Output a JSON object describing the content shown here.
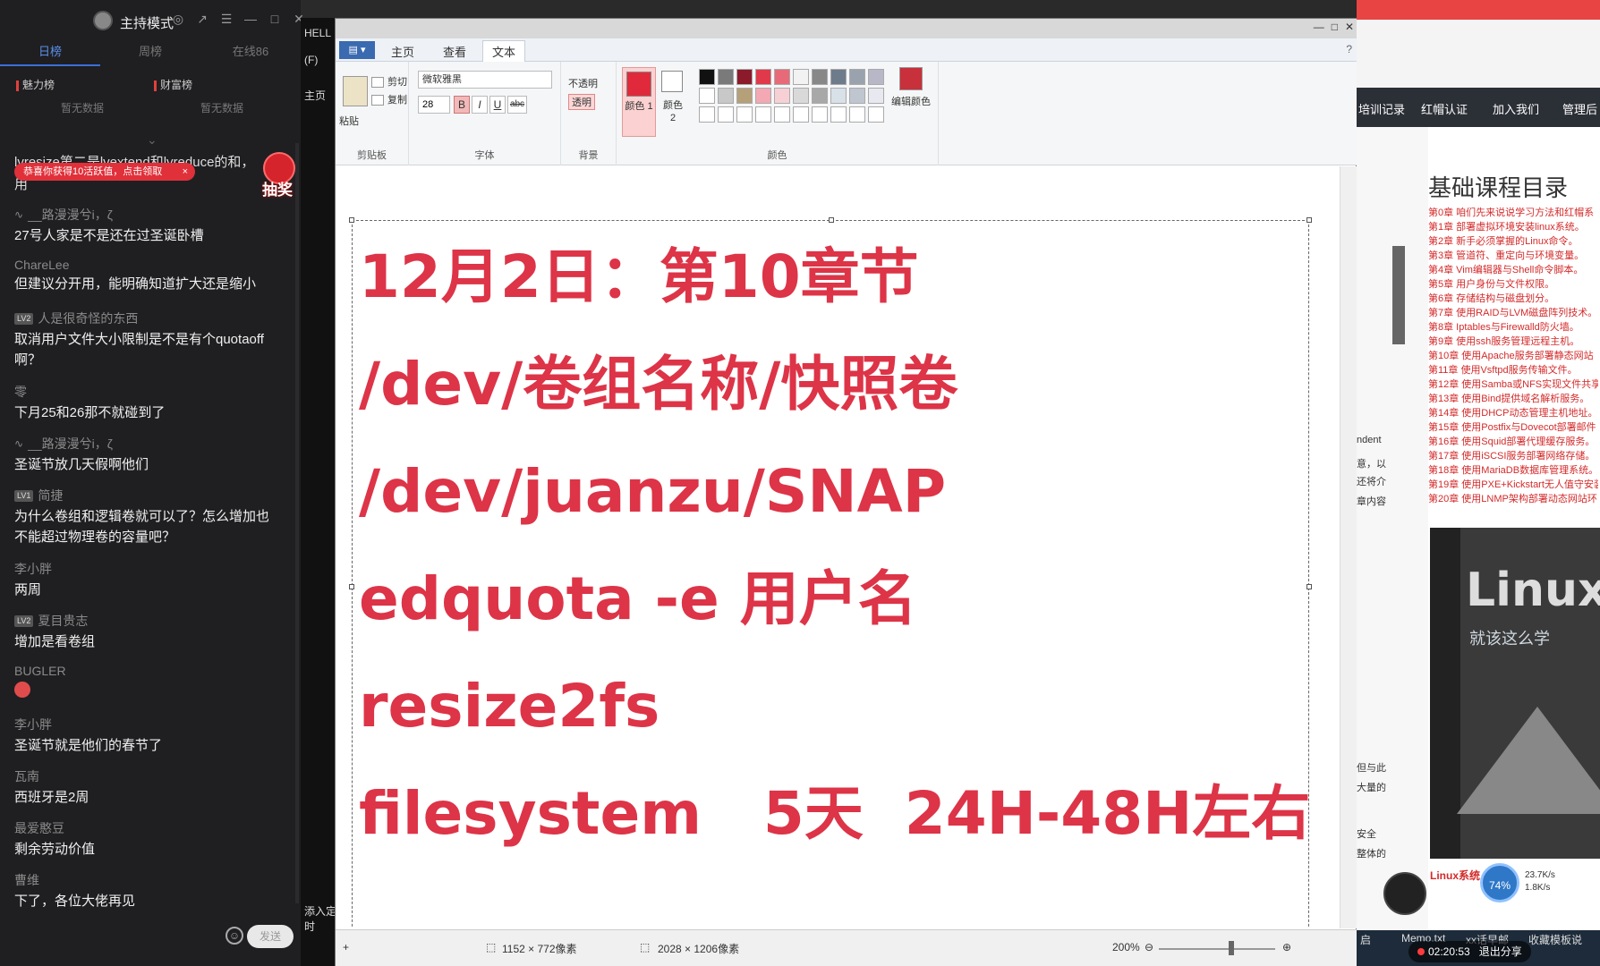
{
  "chat": {
    "title": "主持模式",
    "tabs": [
      "日榜",
      "周榜",
      "在线86"
    ],
    "rank_charm": "魅力榜",
    "rank_wealth": "财富榜",
    "rank_charm_empty": "暂无数据",
    "rank_wealth_empty": "暂无数据",
    "toast": "恭喜你获得10活跃值，点击领取",
    "lottery": "抽奖",
    "partial_top": "lvresize第二是lvextend和lvreduce的和，",
    "partial_top2": "用",
    "messages": [
      {
        "user": "__路漫漫兮i，ζ",
        "text": "27号人家是不是还在过圣诞卧槽"
      },
      {
        "user": "ChareLee",
        "text": "但建议分开用，能明确知道扩大还是缩小"
      },
      {
        "level": "LV2",
        "user": "人是很奇怪的东西",
        "text": "取消用户文件大小限制是不是有个quotaoff啊？"
      },
      {
        "user": "零",
        "text": "下月25和26那不就碰到了"
      },
      {
        "user": "__路漫漫兮i，ζ",
        "text": "圣诞节放几天假啊他们"
      },
      {
        "level": "LV1",
        "user": "简捷",
        "text": "为什么卷组和逻辑卷就可以了？怎么增加也不能超过物理卷的容量吧？"
      },
      {
        "user": "李小胖",
        "text": "两周"
      },
      {
        "level": "LV2",
        "user": "夏目贵志",
        "text": "增加是看卷组"
      },
      {
        "user": "BUGLER",
        "text": ""
      },
      {
        "user": "李小胖",
        "text": "圣诞节就是他们的春节了"
      },
      {
        "user": "瓦南",
        "text": "西班牙是2周"
      },
      {
        "user": "最爱憨豆",
        "text": "剩余劳动价值"
      },
      {
        "user": "曹维",
        "text": "下了，各位大佬再见"
      }
    ],
    "send_label": "发送"
  },
  "mid": {
    "label1": "HELL",
    "label2": "(F)",
    "label3": "主页",
    "label4": "添入定时"
  },
  "paint": {
    "menu_file": "文件",
    "tabs": [
      "主页",
      "查看",
      "文本"
    ],
    "clipboard": {
      "paste": "粘贴",
      "cut": "剪切",
      "copy": "复制",
      "label": "剪贴板"
    },
    "font": {
      "family": "微软雅黑",
      "size": "28",
      "label": "字体"
    },
    "background": {
      "opaque": "不透明",
      "transparent": "透明",
      "label": "背景"
    },
    "colors": {
      "color1": "颜色 1",
      "color2": "颜色 2",
      "edit": "编辑颜色",
      "label": "颜色"
    },
    "canvas_lines": [
      "12月2日：第10章节",
      "/dev/卷组名称/快照卷",
      "/dev/juanzu/SNAP",
      "edquota -e 用户名",
      "resize2fs",
      "filesystem   5天  24H-48H左右"
    ],
    "status_selection": "1152 × 772像素",
    "status_size": "2028 × 1206像素",
    "zoom": "200%"
  },
  "browser": {
    "nav": [
      "培训记录",
      "红帽认证",
      "加入我们",
      "管理后"
    ],
    "course_title": "基础课程目录",
    "courses": [
      "第0章 咱们先来说说学习方法和红帽系",
      "第1章 部署虚拟环境安装linux系统。",
      "第2章 新手必须掌握的Linux命令。",
      "第3章 管道符、重定向与环境变量。",
      "第4章 Vim编辑器与Shell命令脚本。",
      "第5章 用户身份与文件权限。",
      "第6章 存储结构与磁盘划分。",
      "第7章 使用RAID与LVM磁盘阵列技术。",
      "第8章 Iptables与Firewalld防火墙。",
      "第9章 使用ssh服务管理远程主机。",
      "第10章 使用Apache服务部署静态网站",
      "第11章 使用Vsftpd服务传输文件。",
      "第12章 使用Samba或NFS实现文件共享",
      "第13章 使用Bind提供域名解析服务。",
      "第14章 使用DHCP动态管理主机地址。",
      "第15章 使用Postfix与Dovecot部署邮件",
      "第16章 使用Squid部署代理缓存服务。",
      "第17章 使用iSCSI服务部署网络存储。",
      "第18章 使用MariaDB数据库管理系统。",
      "第19章 使用PXE+Kickstart无人值守安装",
      "第20章 使用LNMP架构部署动态网站环"
    ],
    "side_snippets": [
      "ndent",
      "意，以",
      "还将介",
      "章内容",
      "但与此",
      "大量的",
      "安全",
      "整体的"
    ],
    "book_logo": "Linux",
    "book_sub": "就该这么学",
    "bottom_red": "Linux系统",
    "speed_pct": "74%",
    "speed_up": "23.7K/s",
    "speed_down": "1.8K/s",
    "taskbar": [
      "启",
      "Memo.txt",
      "xx话早邮",
      "收藏模板说"
    ],
    "timer": "02:20:53",
    "exit_share": "退出分享"
  }
}
